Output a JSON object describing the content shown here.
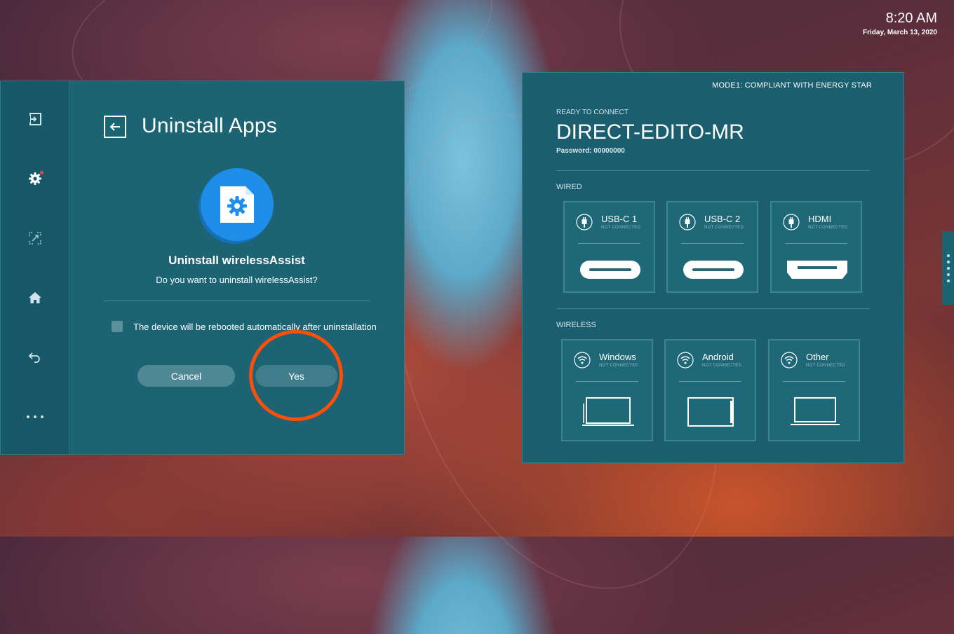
{
  "clock": {
    "time": "8:20 AM",
    "date": "Friday, March 13, 2020"
  },
  "sidebar": {
    "items": [
      {
        "icon": "exit-icon",
        "label": "Exit"
      },
      {
        "icon": "settings-gear-icon",
        "label": "Settings",
        "active": true,
        "notification": true
      },
      {
        "icon": "screen-share-icon",
        "label": "Screen share"
      },
      {
        "icon": "home-icon",
        "label": "Home"
      },
      {
        "icon": "back-arrow-icon",
        "label": "Back"
      },
      {
        "icon": "more-icon",
        "label": "More"
      }
    ]
  },
  "dialog": {
    "title": "Uninstall Apps",
    "app_icon": "app-settings-file-icon",
    "app_title": "Uninstall wirelessAssist",
    "question": "Do you want to uninstall wirelessAssist?",
    "reboot_label": "The device will be rebooted automatically after uninstallation",
    "reboot_checked": false,
    "cancel_label": "Cancel",
    "yes_label": "Yes"
  },
  "connection": {
    "mode": "MODE1: COMPLIANT WITH ENERGY STAR",
    "ready_label": "READY TO CONNECT",
    "ssid": "DIRECT-EDITO-MR",
    "password": "Password: 00000000",
    "wired_label": "WIRED",
    "wireless_label": "WIRELESS",
    "wired": [
      {
        "name": "USB-C 1",
        "status": "NOT CONNECTED",
        "icon": "usb-plug-icon",
        "port": "usb-c-port-icon"
      },
      {
        "name": "USB-C 2",
        "status": "NOT CONNECTED",
        "icon": "usb-plug-icon",
        "port": "usb-c-port-icon"
      },
      {
        "name": "HDMI",
        "status": "NOT CONNECTED",
        "icon": "usb-plug-icon",
        "port": "hdmi-port-icon"
      }
    ],
    "wireless": [
      {
        "name": "Windows",
        "status": "NOT CONNECTED",
        "icon": "wifi-icon",
        "device": "laptop-icon"
      },
      {
        "name": "Android",
        "status": "NOT CONNECTED",
        "icon": "wifi-icon",
        "device": "tablet-icon"
      },
      {
        "name": "Other",
        "status": "NOT CONNECTED",
        "icon": "wifi-icon",
        "device": "laptop-icon"
      }
    ]
  },
  "colors": {
    "panel": "#1c6474",
    "sidebar": "#175868",
    "accent_blue": "#1e8ee8",
    "highlight_ring": "#ff4e08",
    "notification_dot": "#ff3b30"
  }
}
